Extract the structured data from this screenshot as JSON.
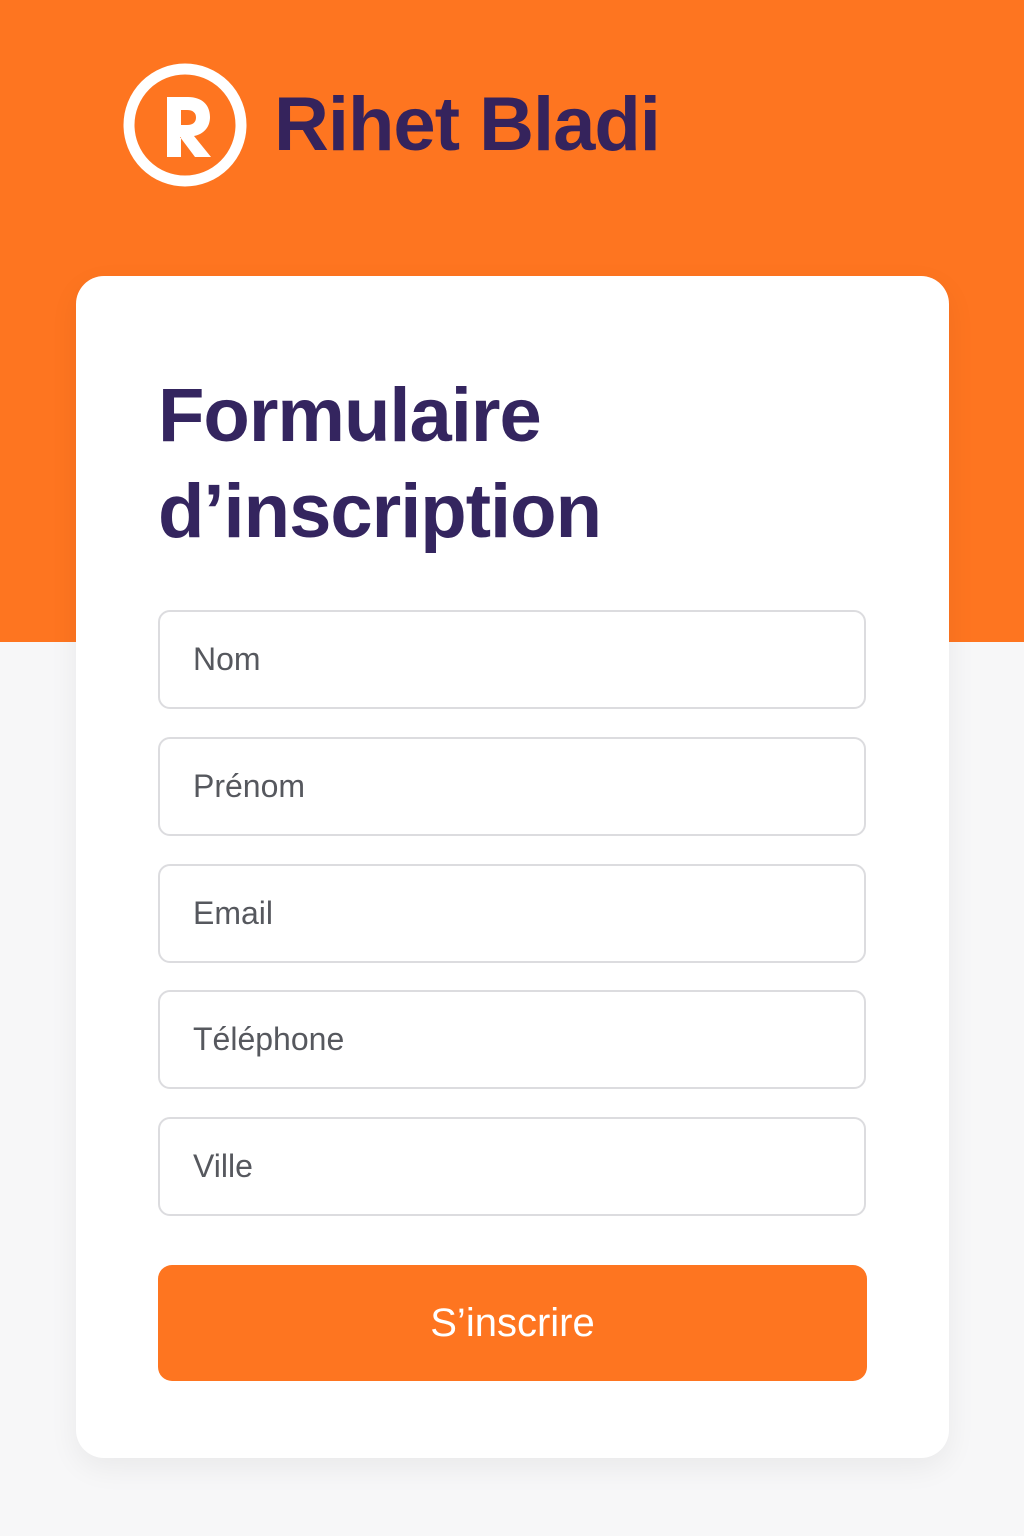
{
  "brand": {
    "name": "Rihet Bladi",
    "logo_icon": "r-circle-logo-icon"
  },
  "form": {
    "title": "Formulaire d’inscription",
    "fields": [
      {
        "name": "nom",
        "placeholder": "Nom",
        "value": ""
      },
      {
        "name": "prenom",
        "placeholder": "Prénom",
        "value": ""
      },
      {
        "name": "email",
        "placeholder": "Email",
        "value": ""
      },
      {
        "name": "telephone",
        "placeholder": "Téléphone",
        "value": ""
      },
      {
        "name": "ville",
        "placeholder": "Ville",
        "value": ""
      }
    ],
    "submit_label": "S’inscrire"
  },
  "colors": {
    "accent": "#fe7520",
    "brand_text": "#35235c",
    "title_text": "#34255f",
    "card_background": "#ffffff",
    "page_background": "#f7f7f8",
    "field_border": "#dcdcdf",
    "placeholder_text": "#56585e"
  }
}
